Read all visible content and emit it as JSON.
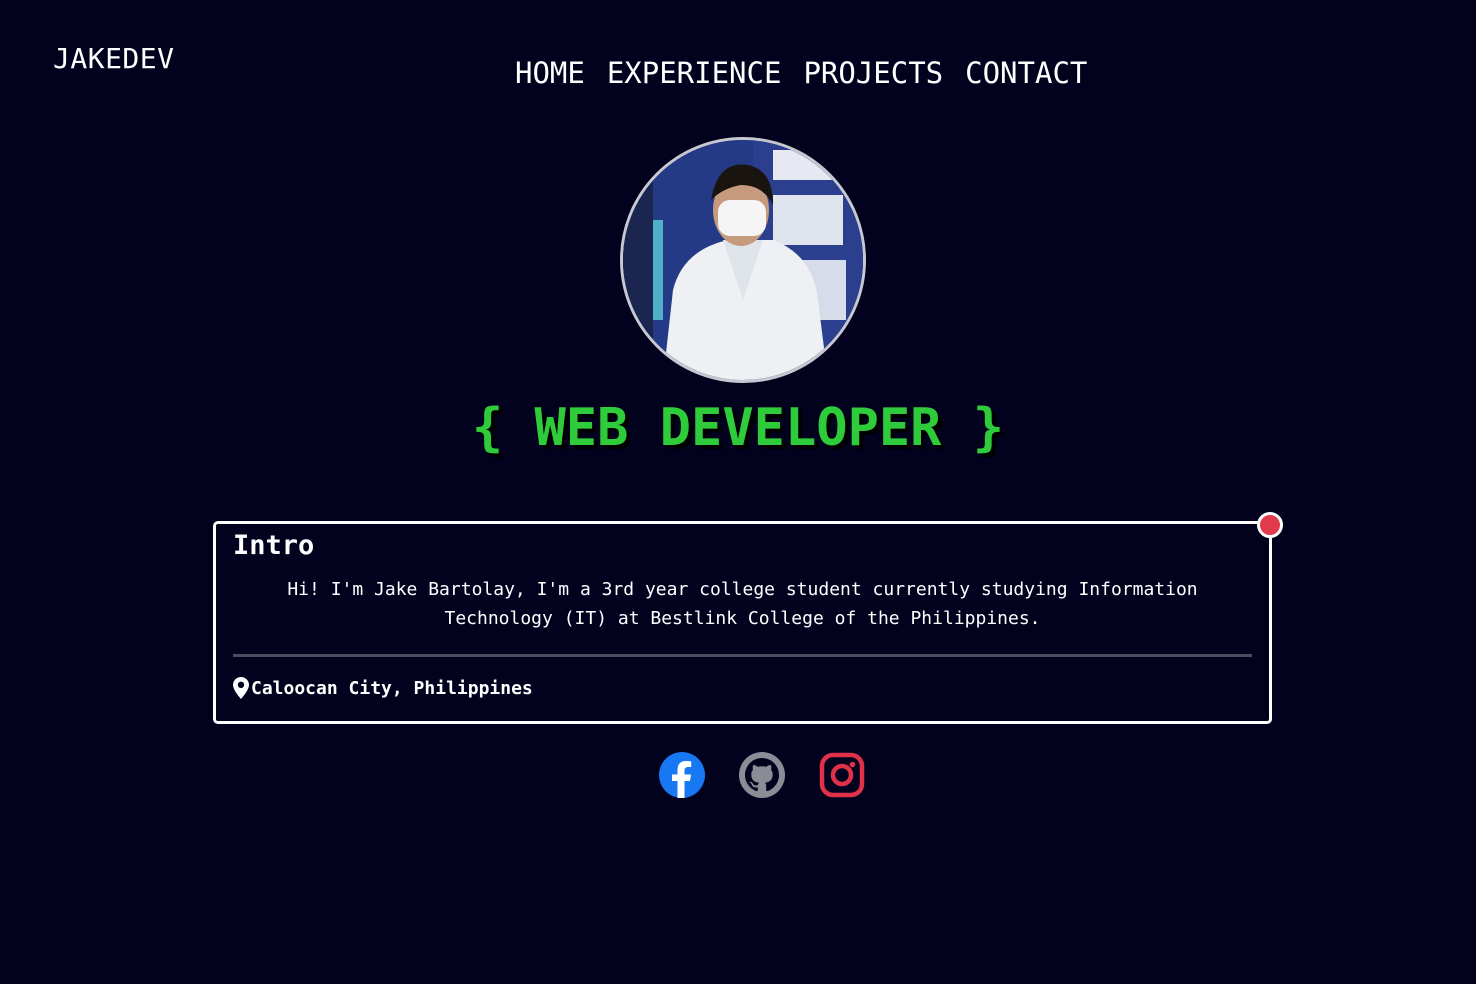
{
  "brand": "JAKEDEV",
  "nav": [
    "HOME",
    "EXPERIENCE",
    "PROJECTS",
    "CONTACT"
  ],
  "headline": "{ WEB DEVELOPER }",
  "intro": {
    "title": "Intro",
    "text": "Hi! I'm Jake Bartolay, I'm a 3rd year college student currently studying Information Technology (IT) at Bestlink College of the Philippines.",
    "location": "Caloocan City, Philippines"
  },
  "socials": [
    {
      "icon": "facebook-icon",
      "color": "#1877f2"
    },
    {
      "icon": "github-icon",
      "color": "#8a8d95"
    },
    {
      "icon": "instagram-icon",
      "color": "#e03149"
    }
  ],
  "colors": {
    "background": "#02021f",
    "accent": "#2ecc3a",
    "status_dot": "#e13a4d"
  }
}
